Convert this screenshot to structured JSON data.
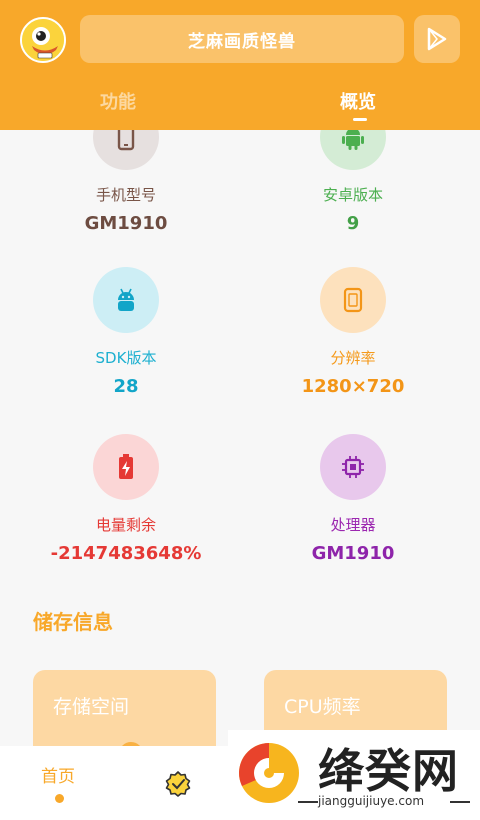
{
  "header": {
    "title": "芝麻画质怪兽",
    "tabs": [
      {
        "label": "功能",
        "active": false
      },
      {
        "label": "概览",
        "active": true
      }
    ]
  },
  "overview": [
    {
      "label": "手机型号",
      "value": "GM1910",
      "icon": "phone-icon",
      "circle_color": "#e6e0df",
      "label_color": "#795548",
      "value_color": "#6d4c41"
    },
    {
      "label": "安卓版本",
      "value": "9",
      "icon": "android-icon",
      "circle_color": "#d4ecd5",
      "label_color": "#4caf50",
      "value_color": "#43a047"
    },
    {
      "label": "SDK版本",
      "value": "28",
      "icon": "android-sdk-icon",
      "circle_color": "#cdeef5",
      "label_color": "#1eb0d0",
      "value_color": "#12a5c8"
    },
    {
      "label": "分辨率",
      "value": "1280×720",
      "icon": "tablet-icon",
      "circle_color": "#fde1bd",
      "label_color": "#f59a1b",
      "value_color": "#f39517"
    },
    {
      "label": "电量剩余",
      "value": "-2147483648%",
      "icon": "battery-icon",
      "circle_color": "#fbd6d6",
      "label_color": "#e53935",
      "value_color": "#e53935"
    },
    {
      "label": "处理器",
      "value": "GM1910",
      "icon": "cpu-icon",
      "circle_color": "#e8c8ec",
      "label_color": "#9c27b0",
      "value_color": "#8e24aa"
    }
  ],
  "storage": {
    "title": "储存信息",
    "cards": [
      {
        "title": "存储空间"
      },
      {
        "title": "CPU频率"
      }
    ]
  },
  "bottom_nav": {
    "home_label": "首页"
  },
  "watermark": {
    "text": "绛癸网",
    "url": "jiangguijiuye.com"
  },
  "colors": {
    "accent": "#f8a82a",
    "card": "#fdd8a3"
  }
}
